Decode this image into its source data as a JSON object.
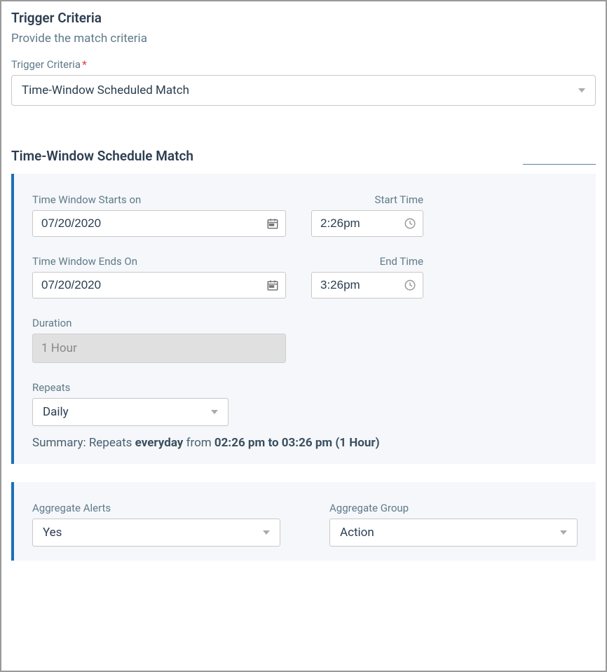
{
  "header": {
    "title": "Trigger Criteria",
    "subtitle": "Provide the match criteria",
    "selectLabel": "Trigger Criteria",
    "selectValue": "Time-Window Scheduled Match"
  },
  "section2": {
    "title": "Time-Window Schedule Match"
  },
  "form": {
    "startDateLabel": "Time Window Starts on",
    "startDateValue": "07/20/2020",
    "startTimeLabel": "Start Time",
    "startTimeValue": "2:26pm",
    "endDateLabel": "Time Window Ends On",
    "endDateValue": "07/20/2020",
    "endTimeLabel": "End Time",
    "endTimeValue": "3:26pm",
    "durationLabel": "Duration",
    "durationValue": "1 Hour",
    "repeatsLabel": "Repeats",
    "repeatsValue": "Daily"
  },
  "summary": {
    "prefix": "Summary: Repeats ",
    "everyday": "everyday",
    "mid": " from ",
    "range": "02:26 pm to 03:26 pm (1 Hour)"
  },
  "aggregate": {
    "alertsLabel": "Aggregate Alerts",
    "alertsValue": "Yes",
    "groupLabel": "Aggregate Group",
    "groupValue": "Action"
  }
}
